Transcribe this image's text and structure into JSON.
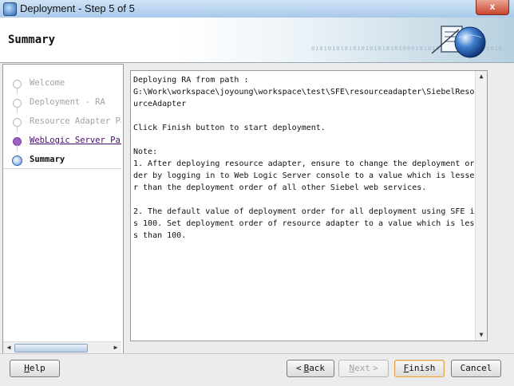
{
  "window": {
    "title": "Deployment - Step 5 of 5",
    "close_glyph": "x"
  },
  "header": {
    "title": "Summary",
    "binary_text": "0101010101010101010101000101010101010010101010"
  },
  "nav": {
    "items": [
      {
        "label": "Welcome",
        "state": "done"
      },
      {
        "label": "Deployment - RA",
        "state": "done"
      },
      {
        "label": "Resource Adapter Pa",
        "state": "done"
      },
      {
        "label": "WebLogic Server Par",
        "state": "visited"
      },
      {
        "label": "Summary",
        "state": "current"
      }
    ]
  },
  "content": {
    "text": "Deploying RA from path :\nG:\\Work\\workspace\\joyoung\\workspace\\test\\SFE\\resourceadapter\\SiebelResourceAdapter\n\nClick Finish button to start deployment.\n\nNote:\n1. After deploying resource adapter, ensure to change the deployment order by logging in to Web Logic Server console to a value which is lesser than the deployment order of all other Siebel web services.\n\n2. The default value of deployment order for all deployment using SFE is 100. Set deployment order of resource adapter to a value which is less than 100."
  },
  "buttons": {
    "help": {
      "ul": "H",
      "rest": "elp"
    },
    "back": {
      "ul": "B",
      "rest": "ack",
      "chev": "<"
    },
    "next": {
      "ul": "N",
      "rest": "ext",
      "chev": ">"
    },
    "finish": {
      "ul": "F",
      "rest": "inish"
    },
    "cancel": {
      "label": "Cancel"
    }
  },
  "colors": {
    "visited": "#4a0a6e",
    "accent": "#2f66a8",
    "default_button_border": "#e0a04a"
  }
}
